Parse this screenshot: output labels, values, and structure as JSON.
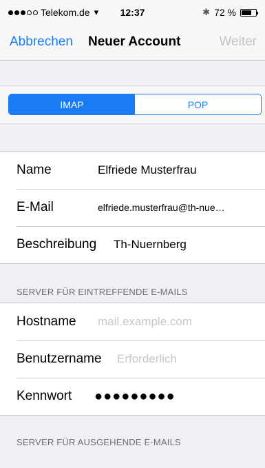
{
  "status_bar": {
    "carrier": "Telekom.de",
    "wifi_icon": "wifi-icon",
    "time": "12:37",
    "bluetooth_icon": "bluetooth-icon",
    "battery_text": "72 %",
    "battery_level": 0.72
  },
  "nav": {
    "cancel": "Abbrechen",
    "title": "Neuer Account",
    "next": "Weiter"
  },
  "segments": {
    "imap": "IMAP",
    "pop": "POP",
    "selected": "IMAP"
  },
  "account": {
    "name_label": "Name",
    "name_value": "Elfriede Musterfrau",
    "email_label": "E-Mail",
    "email_value": "elfriede.musterfrau@th-nue…",
    "desc_label": "Beschreibung",
    "desc_value": "Th-Nuernberg"
  },
  "incoming": {
    "header": "SERVER FÜR EINTREFFENDE E-MAILS",
    "hostname_label": "Hostname",
    "hostname_placeholder": "mail.example.com",
    "username_label": "Benutzername",
    "username_placeholder": "Erforderlich",
    "password_label": "Kennwort",
    "password_value": "●●●●●●●●●"
  },
  "outgoing": {
    "header": "SERVER FÜR AUSGEHENDE E-MAILS"
  },
  "colors": {
    "accent": "#1a7cf5",
    "background": "#efeff4",
    "disabled": "#c4c4c8"
  }
}
